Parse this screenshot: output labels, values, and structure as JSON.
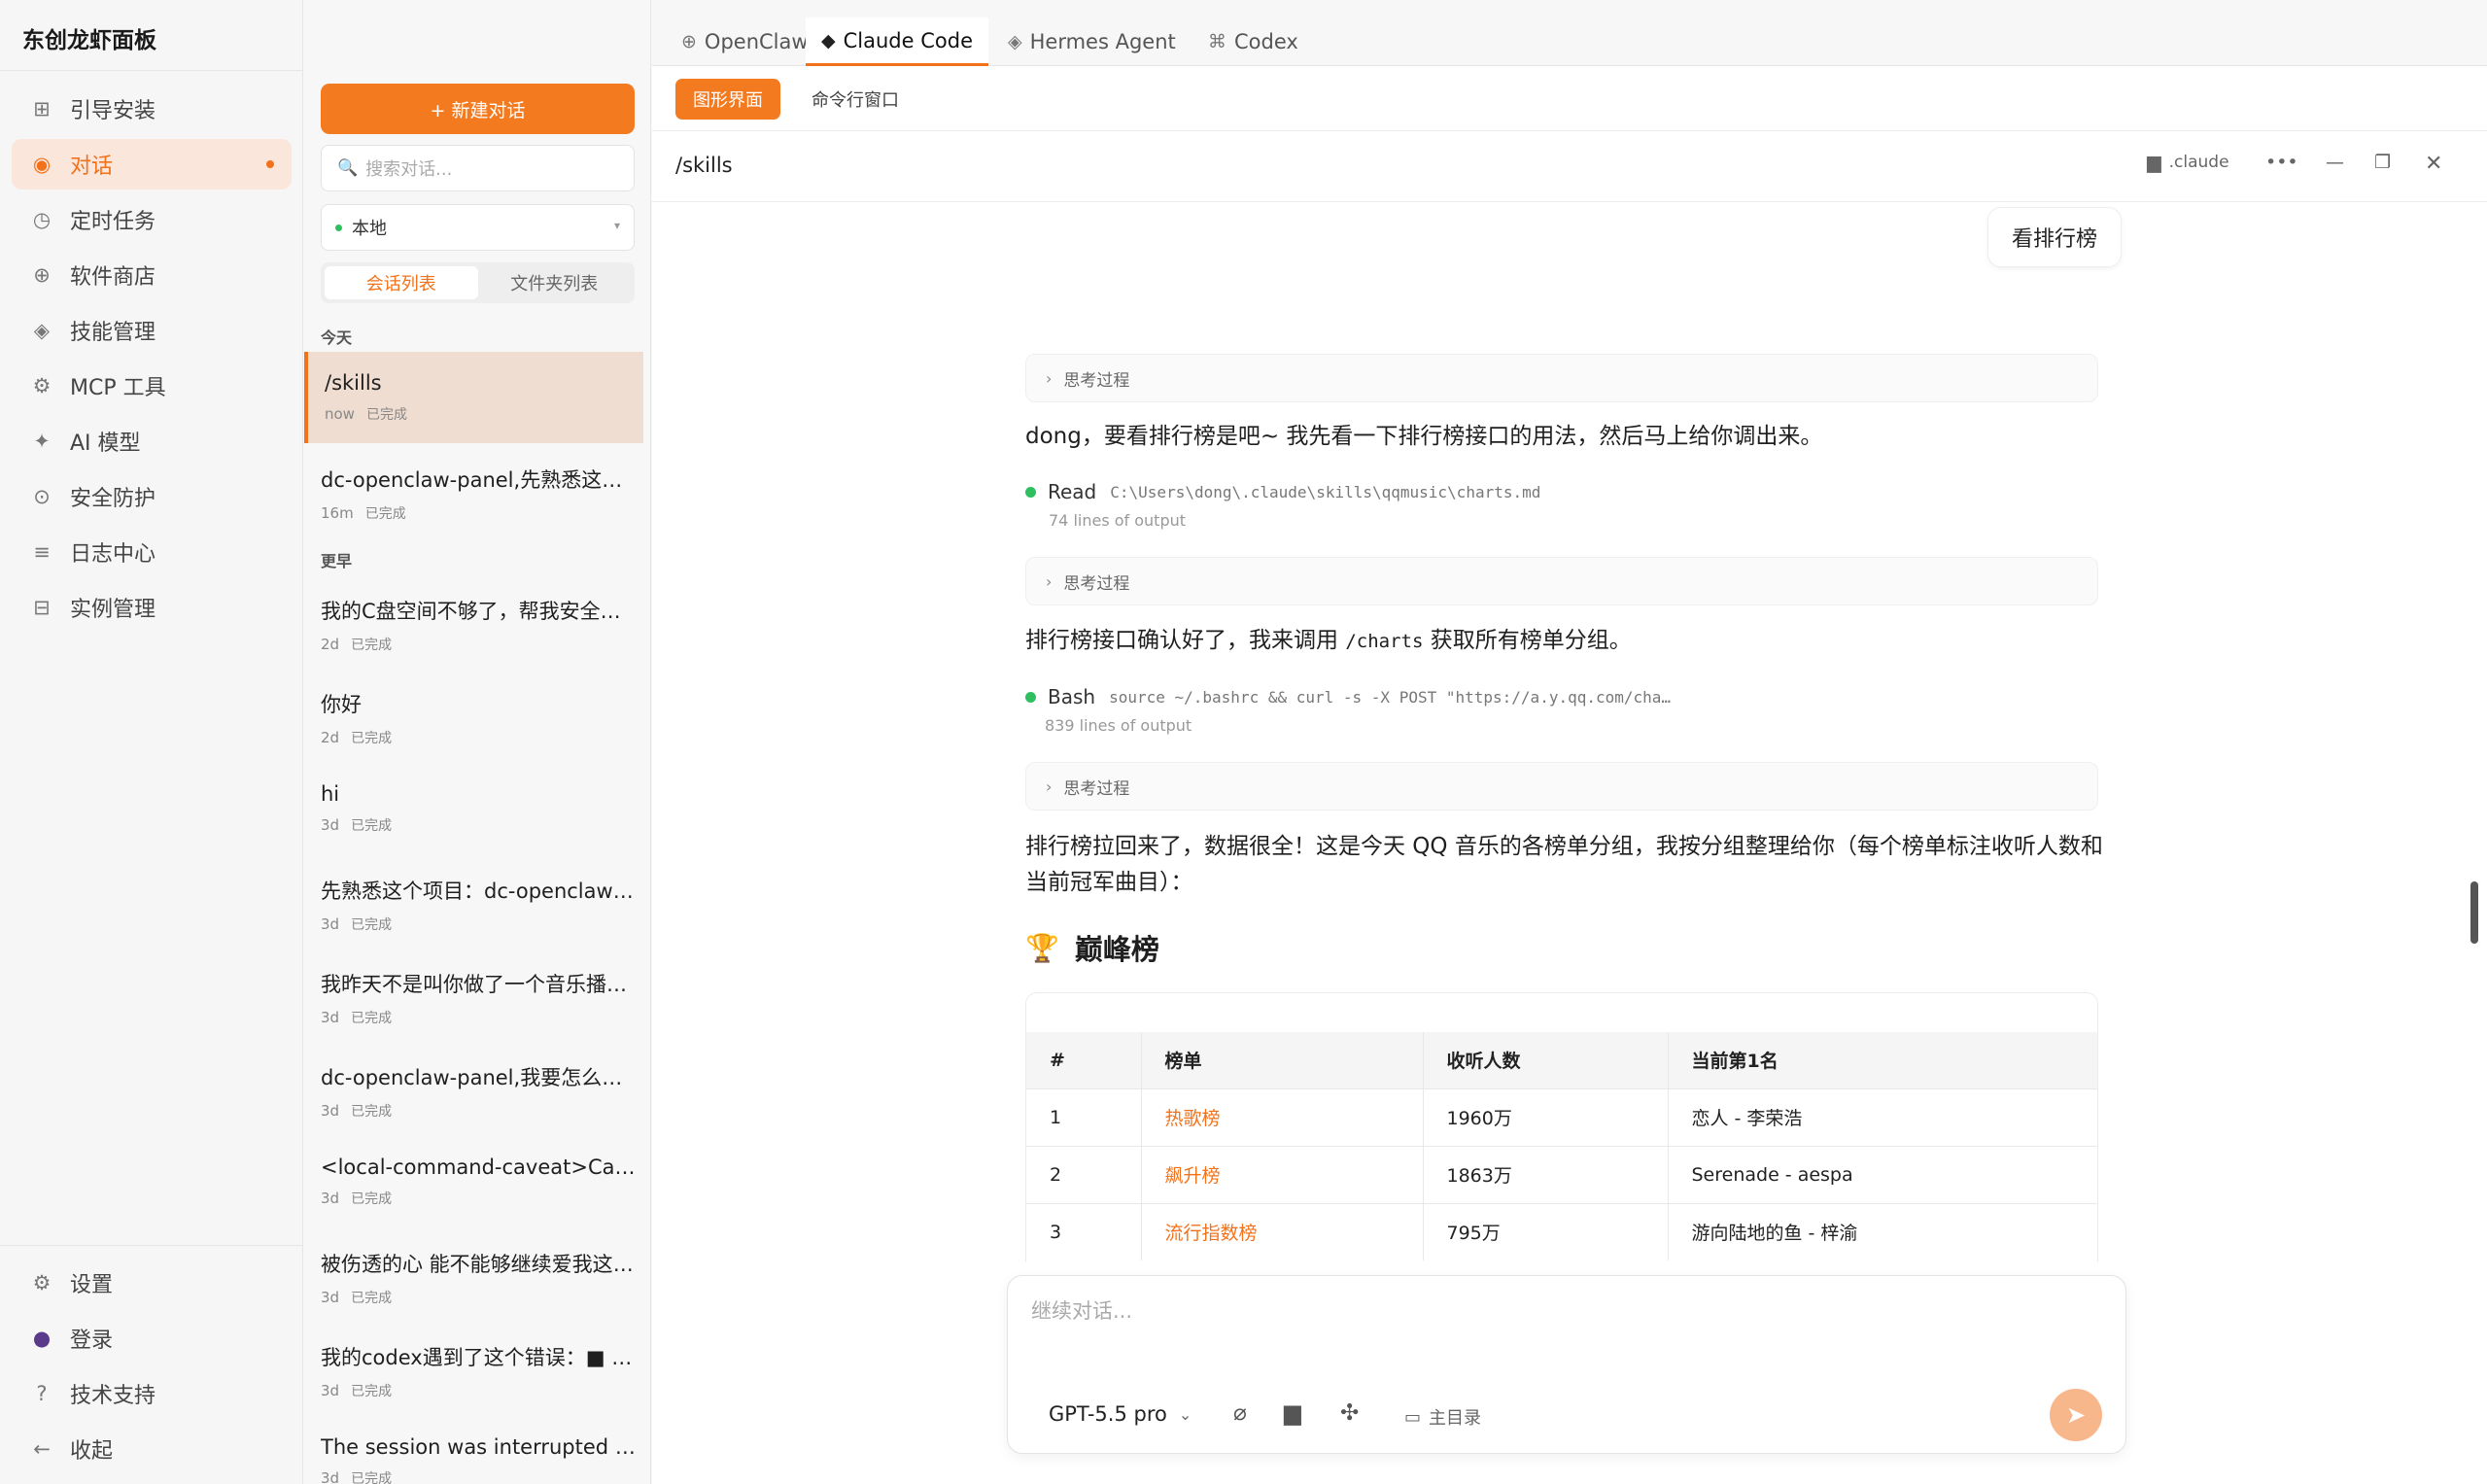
{
  "sidebar": {
    "brand": "东创龙虾面板",
    "items": [
      {
        "label": "引导安装",
        "icon": "grid-icon"
      },
      {
        "label": "对话",
        "icon": "target-icon"
      },
      {
        "label": "定时任务",
        "icon": "clock-icon"
      },
      {
        "label": "软件商店",
        "icon": "plus-circle-icon"
      },
      {
        "label": "技能管理",
        "icon": "diamond-icon"
      },
      {
        "label": "MCP 工具",
        "icon": "gear-icon"
      },
      {
        "label": "AI 模型",
        "icon": "sparkle-icon"
      },
      {
        "label": "安全防护",
        "icon": "shield-icon"
      },
      {
        "label": "日志中心",
        "icon": "list-icon"
      },
      {
        "label": "实例管理",
        "icon": "window-icon"
      }
    ],
    "bottom": [
      {
        "label": "设置",
        "icon": "gear-icon"
      },
      {
        "label": "登录",
        "icon": "user-icon"
      },
      {
        "label": "技术支持",
        "icon": "question-icon"
      },
      {
        "label": "收起",
        "icon": "arrow-left-icon"
      }
    ]
  },
  "sessions": {
    "new_label": "+ 新建对话",
    "search_placeholder": "搜索对话...",
    "location": "本地",
    "seg_sessions": "会话列表",
    "seg_folders": "文件夹列表",
    "group_today": "今天",
    "group_earlier": "更早",
    "today": [
      {
        "title": "/skills",
        "time": "now",
        "status": "已完成"
      },
      {
        "title": "dc-openclaw-panel,先熟悉这个项目",
        "time": "16m",
        "status": "已完成"
      }
    ],
    "earlier": [
      {
        "title": "我的C盘空间不够了，帮我安全清理一下",
        "time": "2d",
        "status": "已完成"
      },
      {
        "title": "你好",
        "time": "2d",
        "status": "已完成"
      },
      {
        "title": "hi",
        "time": "3d",
        "status": "已完成"
      },
      {
        "title": "先熟悉这个项目：dc-openclaw-panel",
        "time": "3d",
        "status": "已完成"
      },
      {
        "title": "我昨天不是叫你做了一个音乐播放器吗",
        "time": "3d",
        "status": "已完成"
      },
      {
        "title": "dc-openclaw-panel,我要怎么启动它",
        "time": "3d",
        "status": "已完成"
      },
      {
        "title": "<local-command-caveat>Caveat: The messages",
        "time": "3d",
        "status": "已完成"
      },
      {
        "title": "被伤透的心 能不能够继续爱我这首歌",
        "time": "3d",
        "status": "已完成"
      },
      {
        "title": "我的codex遇到了这个错误：■ stream",
        "time": "3d",
        "status": "已完成"
      },
      {
        "title": "The session was interrupted and needs",
        "time": "3d",
        "status": "已完成"
      }
    ]
  },
  "tabs": [
    {
      "label": "OpenClaw",
      "icon": "globe-icon"
    },
    {
      "label": "Claude Code",
      "icon": "sparkle-icon"
    },
    {
      "label": "Hermes Agent",
      "icon": "diamond-icon"
    },
    {
      "label": "Codex",
      "icon": "command-icon"
    }
  ],
  "modes": {
    "gui": "图形界面",
    "cli": "命令行窗口"
  },
  "titlebar": {
    "title": "/skills",
    "folder": ".claude"
  },
  "chat": {
    "user_msg": "看排行榜",
    "think_label": "思考过程",
    "p1": "dong，要看排行榜是吧~ 我先看一下排行榜接口的用法，然后马上给你调出来。",
    "tool1": {
      "name": "Read",
      "arg": "C:\\Users\\dong\\.claude\\skills\\qqmusic\\charts.md",
      "sub": "74 lines of output"
    },
    "p2_pre": "排行榜接口确认好了，我来调用",
    "p2_code": "/charts",
    "p2_post": "获取所有榜单分组。",
    "tool2": {
      "name": "Bash",
      "arg": "source ~/.bashrc && curl -s -X POST \"https://a.y.qq.com/cha…",
      "sub": "839 lines of output"
    },
    "p3": "排行榜拉回来了，数据很全！这是今天 QQ 音乐的各榜单分组，我按分组整理给你（每个榜单标注收听人数和当前冠军曲目）：",
    "h3": "巅峰榜",
    "table": {
      "headers": [
        "#",
        "榜单",
        "收听人数",
        "当前第1名"
      ],
      "rows": [
        [
          "1",
          "热歌榜",
          "1960万",
          "恋人 - 李荣浩"
        ],
        [
          "2",
          "飙升榜",
          "1863万",
          "Serenade - aespa"
        ],
        [
          "3",
          "流行指数榜",
          "795万",
          "游向陆地的鱼 - 梓渝"
        ]
      ]
    }
  },
  "composer": {
    "placeholder": "继续对话...",
    "model": "GPT-5.5 pro",
    "dir": "主目录"
  },
  "colors": {
    "accent": "#f47a1f",
    "success": "#2fbf5f"
  }
}
